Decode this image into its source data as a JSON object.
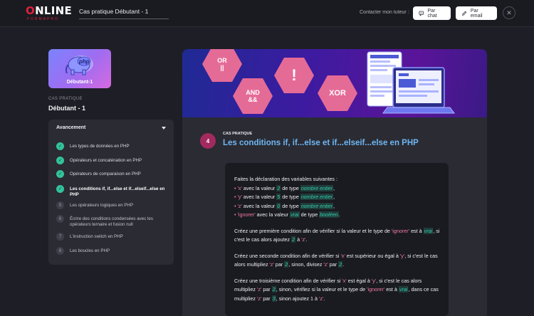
{
  "header": {
    "logo_main_o": "O",
    "logo_main_rest": "NLINE",
    "logo_sub": "FORMAPRO",
    "course_title": "Cas pratique Débutant - 1",
    "contact_label": "Contacter mon tuteur :",
    "chat_label": "Par chat",
    "email_label": "Par email",
    "close_symbol": "✕"
  },
  "sidebar": {
    "badge_label": "Débutant-1",
    "badge_art_text": "php",
    "kicker": "CAS PRATIQUE",
    "title": "Débutant - 1",
    "progress_title": "Avancement",
    "steps": [
      {
        "marker": "✓",
        "label": "Les types de données en PHP",
        "status": "done"
      },
      {
        "marker": "✓",
        "label": "Opérateurs et concaténation en PHP",
        "status": "done"
      },
      {
        "marker": "✓",
        "label": "Opérateurs de comparaison en PHP",
        "status": "done"
      },
      {
        "marker": "✓",
        "label": "Les conditions if, if...else et if...elseif...else en PHP",
        "status": "current"
      },
      {
        "marker": "5",
        "label": "Les opérateurs logiques en PHP",
        "status": "todo"
      },
      {
        "marker": "6",
        "label": "Écrire des conditions condensées avec les opérateurs ternaire et fusion null",
        "status": "todo"
      },
      {
        "marker": "7",
        "label": "L'instruction switch en PHP",
        "status": "todo"
      },
      {
        "marker": "8",
        "label": "Les boucles en PHP",
        "status": "todo"
      }
    ]
  },
  "banner": {
    "hex_or_line1": "OR",
    "hex_or_line2": "||",
    "hex_and_line1": "AND",
    "hex_and_line2": "&&",
    "hex_bang": "!",
    "hex_xor": "XOR"
  },
  "lesson": {
    "number": "4",
    "kicker": "CAS PRATIQUE",
    "title": "Les conditions if, if...else et if...elseif...else en PHP"
  },
  "exercise": {
    "intro": "Faites la déclaration des variables suivantes :",
    "vars": [
      {
        "bullet": "•",
        "name": "'x'",
        "t1": "avec la valeur",
        "val": "2",
        "t2": "de type",
        "type": "nombre entier",
        "end": ","
      },
      {
        "bullet": "•",
        "name": "'y'",
        "t1": "avec la valeur",
        "val": "5",
        "t2": "de type",
        "type": "nombre entier",
        "end": ","
      },
      {
        "bullet": "•",
        "name": "'z'",
        "t1": "avec la valeur",
        "val": "0",
        "t2": "de type",
        "type": "nombre entier",
        "end": ","
      },
      {
        "bullet": "•",
        "name": "'ignorer'",
        "t1": "avec la valeur",
        "val": "vrai",
        "t2": "de type",
        "type": "booléen",
        "end": "."
      }
    ],
    "p2": {
      "a": "Créez une première condition afin de vérifier si la valeur et le type de",
      "b": "'ignorer'",
      "c": "est à",
      "d": "vrai",
      "e": ", si c'est le cas alors ajoutez",
      "f": "2",
      "g": "à",
      "h": "'z'",
      "i": "."
    },
    "p3": {
      "a": "Créez une seconde condition afin de vérifier si",
      "b": "'x'",
      "c": "est supérieur ou égal à",
      "d": "'y'",
      "e": ", si c'est le cas alors multipliez",
      "f": "'z'",
      "g": "par",
      "h": "2",
      "i": ", sinon, divisez",
      "j": "'z'",
      "k": "par",
      "l": "2",
      "m": "."
    },
    "p4": {
      "a": "Créez une troisième condition afin de vérifier si",
      "b": "'x'",
      "c": "est égal à",
      "d": "'y'",
      "e": ", si c'est le cas alors multipliez",
      "f": "'z'",
      "g": "par",
      "h": "2",
      "i": ", sinon, vérifiez si la valeur et le type de",
      "j": "'ignorer'",
      "k": "est à",
      "l": "vrai",
      "m": ", dans ce cas multipliez",
      "n": "'z'",
      "o": "par",
      "p": "3",
      "q": ", sinon ajoutez 1 à",
      "r": "'z'",
      "s": "."
    }
  },
  "colors": {
    "accent_green": "#33c29b",
    "accent_blue": "#6fb6f2",
    "accent_pink": "#e56b97",
    "lesson_badge": "#a32a5e"
  }
}
